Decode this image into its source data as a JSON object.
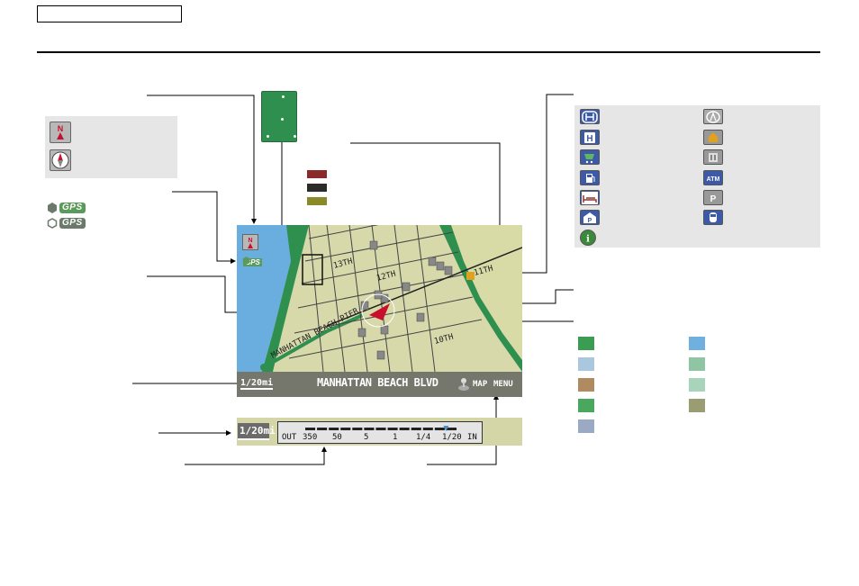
{
  "map": {
    "street_name": "MANHATTAN BEACH BLVD",
    "scale": "1/20mi",
    "map_button": "MAP",
    "menu_button": "MENU",
    "labels": {
      "street_13th": "13TH",
      "street_12th": "12TH",
      "street_11th": "11TH",
      "street_10th": "10TH",
      "pier": "MANHATTAN BEACH PIER"
    }
  },
  "zoom": {
    "scale": "1/20mi",
    "out_label": "OUT",
    "in_label": "IN",
    "ticks": [
      "350",
      "50",
      "5",
      "1",
      "1/4",
      "1/20"
    ],
    "level_fraction": 0.92
  },
  "orientation": {
    "north_icon": "north-up-icon",
    "heading_icon": "heading-up-icon"
  },
  "gps": {
    "label": "GPS"
  },
  "poi_icons": [
    "honda-dealer-icon",
    "acura-dealer-icon",
    "hospital-icon",
    "waypoint-icon",
    "shopping-icon",
    "restaurant-icon",
    "gas-station-icon",
    "atm-icon",
    "hotel-icon",
    "parking-lot-icon",
    "parking-garage-icon",
    "train-station-icon",
    "information-icon"
  ],
  "colors": {
    "road_major": "#8b2a2a",
    "road_secondary": "#2b2b2b",
    "road_minor": "#8a8a2a",
    "legend": [
      "#3b9c54",
      "#6fb0e0",
      "#a9c8e0",
      "#8fc4a4",
      "#b08a60",
      "#a8d4bc",
      "#4aa85e",
      "#9a9c72",
      "#9aaac4"
    ]
  }
}
